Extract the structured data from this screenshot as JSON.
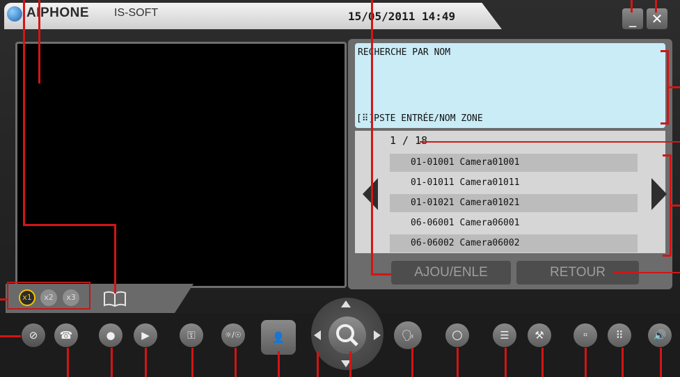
{
  "titlebar": {
    "brand": "AIPHONE",
    "product": "IS-SOFT",
    "datetime": "15/05/2011 14:49"
  },
  "window_buttons": {
    "minimize": "_",
    "close": "✕"
  },
  "zoom": {
    "levels": [
      "x1",
      "x2",
      "x3"
    ],
    "active": "x1"
  },
  "search": {
    "title": "RECHERCHE PAR NOM",
    "hint": "[⠿]PSTE ENTRÉE/NOM ZONE"
  },
  "list": {
    "page": "1 / 18",
    "rows": [
      "01-01001 Camera01001",
      "01-01011 Camera01011",
      "01-01021 Camera01021",
      "06-06001 Camera06001",
      "06-06002 Camera06002"
    ]
  },
  "panel_buttons": {
    "add_remove": "AJOU/ENLE",
    "back": "RETOUR"
  },
  "colors": {
    "callout": "#d31515",
    "zoom_active": "#f5c400",
    "search_bg": "#c9ecf7"
  }
}
